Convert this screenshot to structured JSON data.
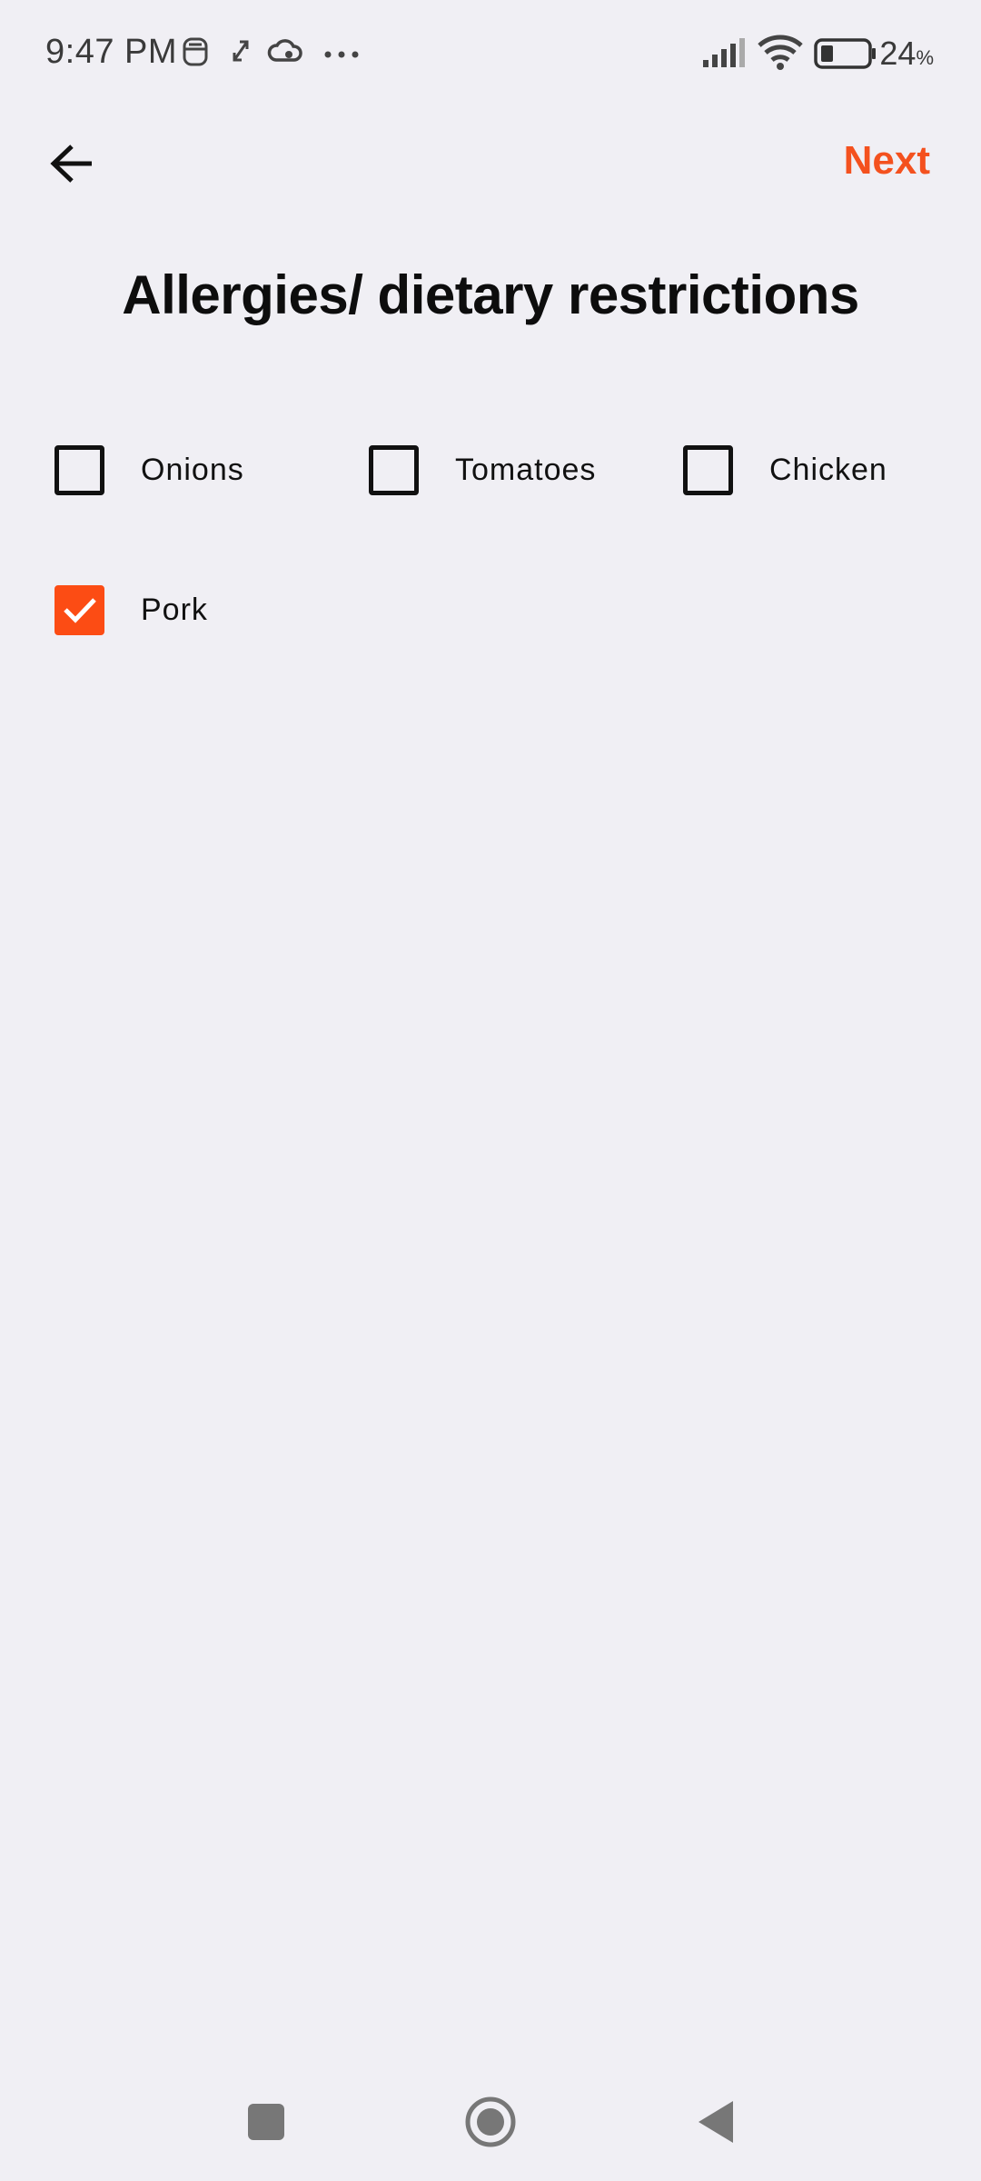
{
  "status_bar": {
    "time": "9:47 PM",
    "battery_percent": "24",
    "battery_suffix": "%"
  },
  "app_bar": {
    "back_icon": "arrow-left-icon",
    "next_label": "Next"
  },
  "title": "Allergies/ dietary restrictions",
  "options": [
    {
      "label": "Onions",
      "checked": false
    },
    {
      "label": "Tomatoes",
      "checked": false
    },
    {
      "label": "Chicken",
      "checked": false
    },
    {
      "label": "Pork",
      "checked": true
    }
  ],
  "colors": {
    "accent": "#f4511e",
    "background": "#f0eff4"
  },
  "nav_bar": {
    "icons": [
      "square-recents-icon",
      "circle-home-icon",
      "triangle-back-icon"
    ]
  }
}
